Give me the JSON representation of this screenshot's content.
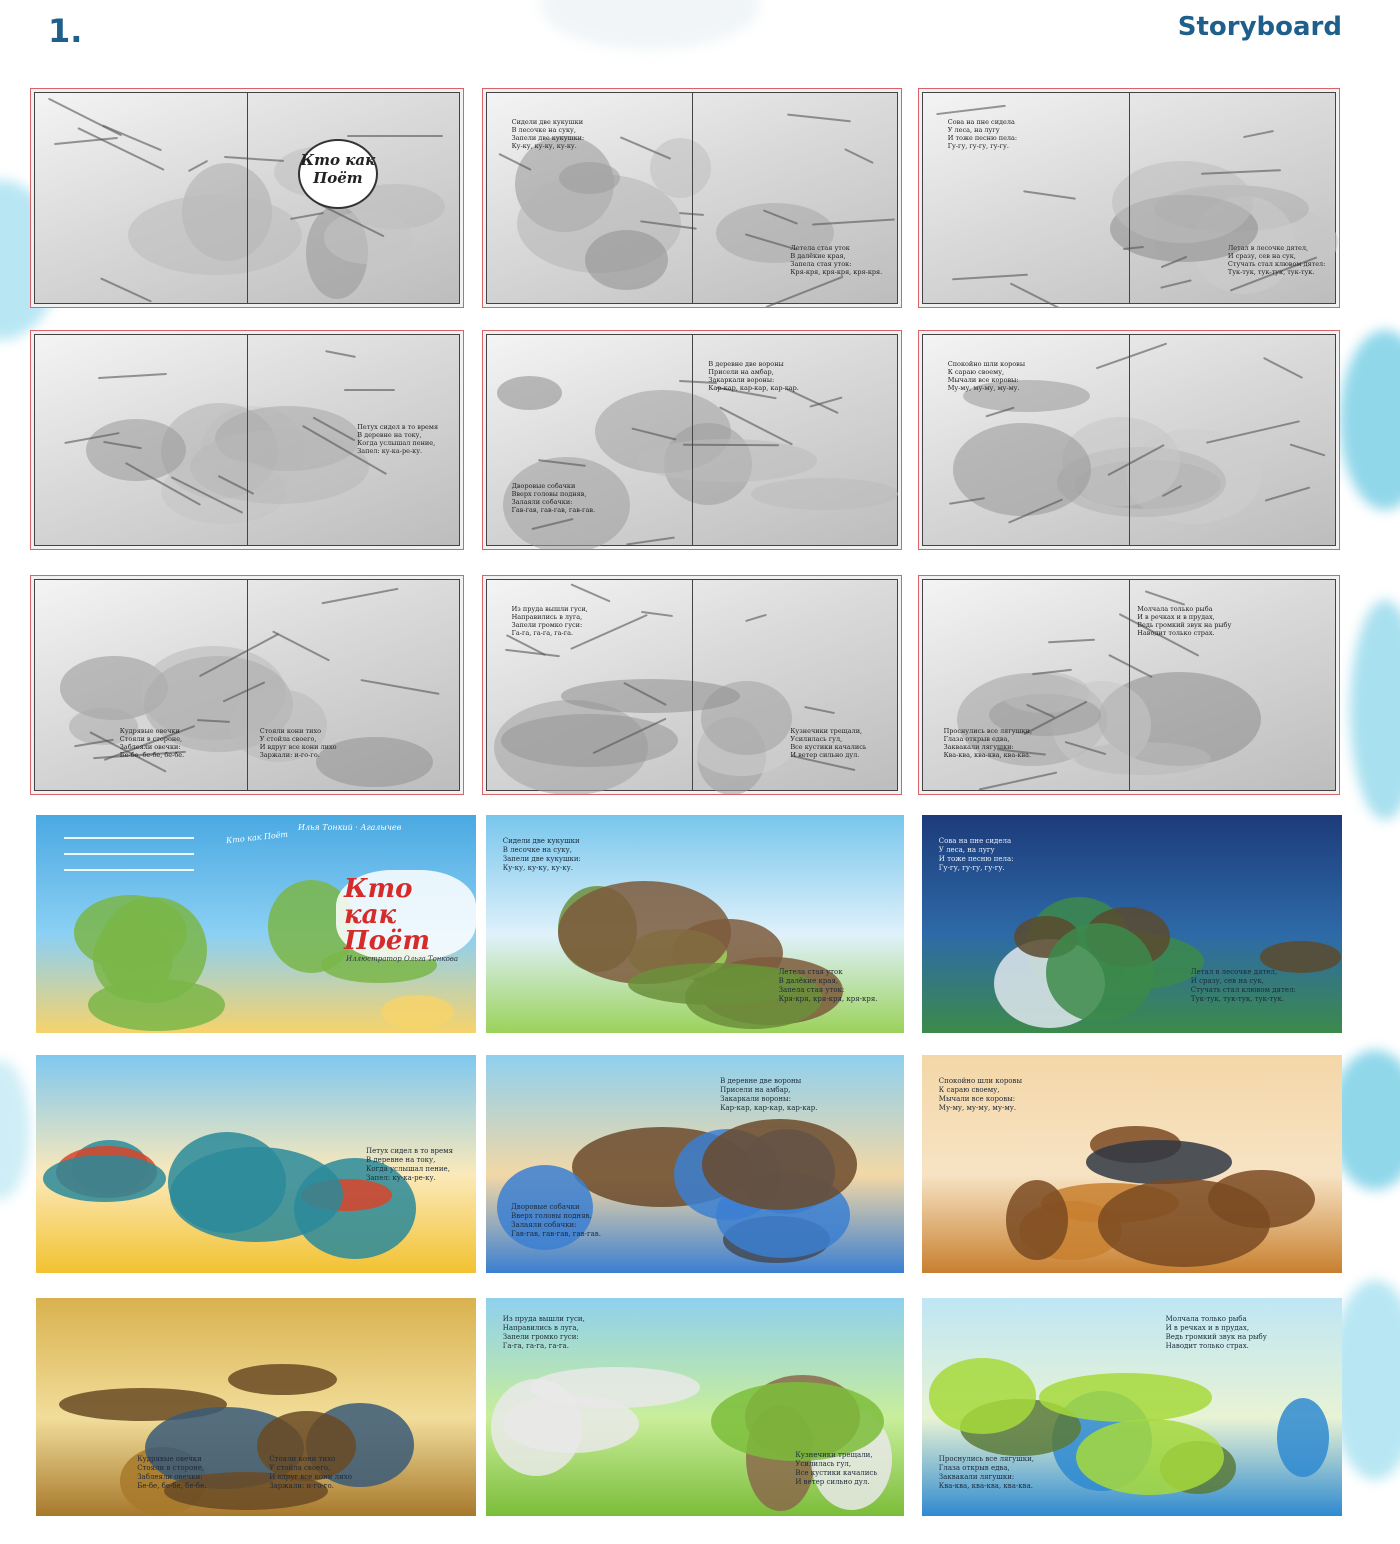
{
  "header": {
    "number": "1.",
    "title": "Storyboard"
  },
  "cover": {
    "title_line1": "Кто как",
    "title_line2": "Поёт",
    "side_text": "Кто как Поёт",
    "author_text": "Илья Тонкий · Агалычев",
    "illustrator_text": "Иллюстратор  Ольга Тонкова"
  },
  "sketch_logo": {
    "line1": "Кто как",
    "line2": "Поёт"
  },
  "spreads": [
    {
      "texts": []
    },
    {
      "texts": [
        "Сидели две кукушки\nВ лесочке на суку,\nЗапели две кукушки:\nКу-ку, ку-ку, ку-ку.",
        "Летела стая уток\nВ далёкие края,\nЗапела стая уток:\nКря-кря, кря-кря, кря-кря."
      ]
    },
    {
      "texts": [
        "Сова на пне сидела\nУ леса, на лугу\nИ тоже песню пела:\nГу-гу, гу-гу, гу-гу.",
        "Летал в лесочке дятел,\nИ сразу, сев на сук,\nСтучать стал клювом дятел:\nТук-тук, тук-тук, тук-тук."
      ]
    },
    {
      "texts": [
        "Петух сидел в то время\nВ деревне на току,\nКогда услышал пение,\nЗапел: ку-ка-ре-ку."
      ]
    },
    {
      "texts": [
        "Дворовые собачки\nВверх головы подняв,\nЗалаяли собачки:\nГав-гав, гав-гав, гав-гав.",
        "В деревне две вороны\nПрисели на амбар,\nЗакаркали вороны:\nКар-кар, кар-кар, кар-кар."
      ]
    },
    {
      "texts": [
        "Спокойно шли коровы\nК сараю своему,\nМычали все коровы:\nМу-му, му-му, му-му."
      ]
    },
    {
      "texts": [
        "Кудрявые овечки\nСтояли в стороне,\nЗаблеяли овечки:\nБе-бе, бе-бе, бе-бе.",
        "Стояли кони тихо\nУ стойла своего,\nИ вдруг все кони лихо\nЗаржали: и-го-го."
      ]
    },
    {
      "texts": [
        "Из пруда вышли гуси,\nНаправились в луга,\nЗапели громко гуси:\nГа-га, га-га, га-га.",
        "Кузнечики трещали,\nУсилилась гул,\nВсе кустики качались\nИ ветер сильно дул."
      ]
    },
    {
      "texts": [
        "Молчала только рыба\nИ в речках и в прудах,\nВедь громкий звук на рыбу\nНаводит только страх.",
        "Проснулись все лягушки,\nГлаза открыв едва,\nЗаквакали лягушки:\nКва-ква, ква-ква, ква-ква."
      ]
    }
  ],
  "finals": [
    {
      "texts": []
    },
    {
      "texts": [
        "Сидели две кукушки\nВ лесочке на суку,\nЗапели две кукушки:\nКу-ку, ку-ку, ку-ку.",
        "Летела стая уток\nВ далёкие края,\nЗапела стая уток:\nКря-кря, кря-кря, кря-кря."
      ]
    },
    {
      "texts": [
        "Сова на пне сидела\nУ леса, на лугу\nИ тоже песню пела:\nГу-гу, гу-гу, гу-гу.",
        "Летал в лесочке дятел,\nИ сразу, сев на сук,\nСтучать стал клювом дятел:\nТук-тук, тук-тук, тук-тук."
      ]
    },
    {
      "texts": [
        "Петух сидел в то время\nВ деревне на току,\nКогда услышал пение,\nЗапел: ку-ка-ре-ку."
      ]
    },
    {
      "texts": [
        "Дворовые собачки\nВверх головы подняв,\nЗалаяли собачки:\nГав-гав, гав-гав, гав-гав.",
        "В деревне две вороны\nПрисели на амбар,\nЗакаркали вороны:\nКар-кар, кар-кар, кар-кар."
      ]
    },
    {
      "texts": [
        "Спокойно шли коровы\nК сараю своему,\nМычали все коровы:\nМу-му, му-му, му-му."
      ]
    },
    {
      "texts": [
        "Кудрявые овечки\nСтояли в стороне,\nЗаблеяли овечки:\nБе-бе, бе-бе, бе-бе.",
        "Стояли кони тихо\nУ стойла своего,\nИ вдруг все кони лихо\nЗаржали: и-го-го."
      ]
    },
    {
      "texts": [
        "Из пруда вышли гуси,\nНаправились в луга,\nЗапели громко гуси:\nГа-га, га-га, га-га.",
        "Кузнечики трещали,\nУсилилась гул,\nВсе кустики качались\nИ ветер сильно дул."
      ]
    },
    {
      "texts": [
        "Молчала только рыба\nИ в речках и в прудах,\nВедь громкий звук на рыбу\nНаводит только страх.",
        "Проснулись все лягушки,\nГлаза открыв едва,\nЗаквакали лягушки:\nКва-ква, ква-ква, ква-ква."
      ]
    }
  ],
  "colors": {
    "heading": "#1f5f8b",
    "splash": "#36b7d9",
    "trim_line": "#d8646a"
  }
}
